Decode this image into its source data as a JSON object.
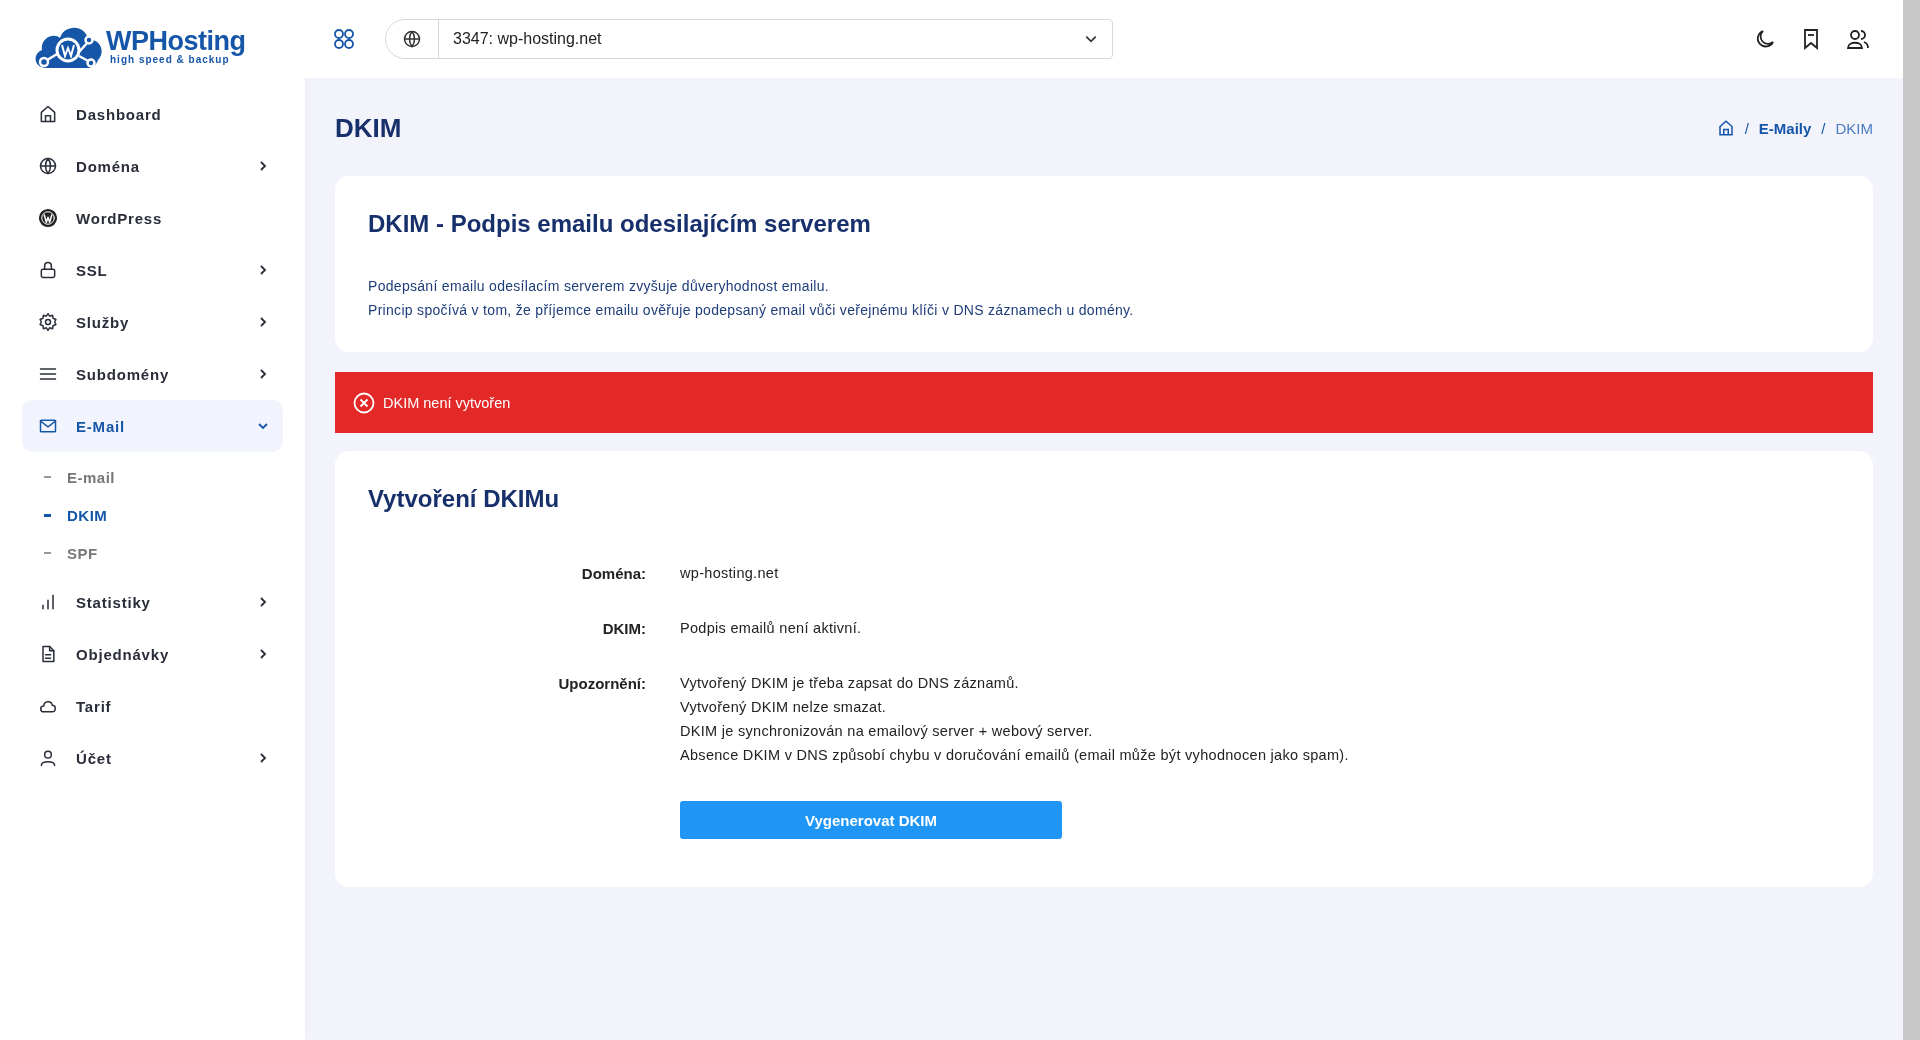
{
  "logo": {
    "name": "WPHosting",
    "tagline": "high speed & backup"
  },
  "sidebar": {
    "items": [
      {
        "label": "Dashboard",
        "has_submenu": false,
        "selected": false
      },
      {
        "label": "Doména",
        "has_submenu": true,
        "expanded": false,
        "selected": false
      },
      {
        "label": "WordPress",
        "has_submenu": false,
        "selected": false
      },
      {
        "label": "SSL",
        "has_submenu": true,
        "expanded": false,
        "selected": false
      },
      {
        "label": "Služby",
        "has_submenu": true,
        "expanded": false,
        "selected": false
      },
      {
        "label": "Subdomény",
        "has_submenu": true,
        "expanded": false,
        "selected": false
      },
      {
        "label": "E-Mail",
        "has_submenu": true,
        "expanded": true,
        "selected": true,
        "children": [
          {
            "label": "E-mail",
            "selected": false
          },
          {
            "label": "DKIM",
            "selected": true
          },
          {
            "label": "SPF",
            "selected": false
          }
        ]
      },
      {
        "label": "Statistiky",
        "has_submenu": true,
        "expanded": false,
        "selected": false
      },
      {
        "label": "Objednávky",
        "has_submenu": true,
        "expanded": false,
        "selected": false
      },
      {
        "label": "Tarif",
        "has_submenu": false,
        "selected": false
      },
      {
        "label": "Účet",
        "has_submenu": true,
        "expanded": false,
        "selected": false
      }
    ]
  },
  "topbar": {
    "domain_select": {
      "value": "3347: wp-hosting.net"
    }
  },
  "page": {
    "title": "DKIM",
    "breadcrumb": [
      {
        "separator": "/",
        "label": "E-Maily",
        "selected": false
      },
      {
        "separator": "/",
        "label": "DKIM",
        "selected": true
      }
    ]
  },
  "info_card": {
    "title": "DKIM - Podpis emailu odesilajícím serverem",
    "lines": [
      "Podepsání emailu odesílacím serverem zvyšuje důveryhodnost emailu.",
      "Princip spočívá v tom, že příjemce emailu ověřuje podepsaný email vůči veřejnému klíči v DNS záznamech u domény."
    ]
  },
  "alert": {
    "message": "DKIM není vytvořen"
  },
  "form_card": {
    "title": "Vytvoření DKIMu",
    "rows": [
      {
        "label": "Doména:",
        "lines": [
          "wp-hosting.net"
        ]
      },
      {
        "label": "DKIM:",
        "lines": [
          "Podpis emailů není aktivní."
        ]
      },
      {
        "label": "Upozornění:",
        "lines": [
          "Vytvořený DKIM je třeba zapsat do DNS záznamů.",
          "Vytvořený DKIM nelze smazat.",
          "DKIM je synchronizován na emailový server + webový server.",
          "Absence DKIM v DNS způsobí chybu v doručování emailů (email může být vyhodnocen jako spam)."
        ]
      }
    ],
    "button": "Vygenerovat DKIM"
  }
}
